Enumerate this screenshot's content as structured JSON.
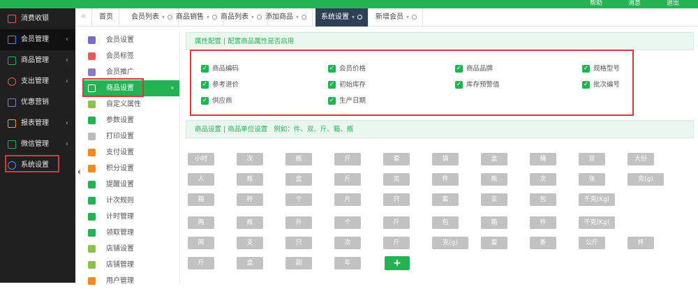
{
  "topbar": {
    "items": [
      "帮助",
      "消息",
      "退出"
    ],
    "color": "#24b353"
  },
  "sidebar": {
    "items": [
      {
        "label": "消费收银",
        "icon": "cashier-icon",
        "chevron": false
      },
      {
        "label": "会员管理",
        "icon": "members-icon",
        "chevron": true
      },
      {
        "label": "商品管理",
        "icon": "goods-icon",
        "chevron": true
      },
      {
        "label": "支出管理",
        "icon": "expense-icon",
        "chevron": true
      },
      {
        "label": "优惠营销",
        "icon": "gift-icon",
        "chevron": false
      },
      {
        "label": "报表管理",
        "icon": "report-icon",
        "chevron": true
      },
      {
        "label": "微信管理",
        "icon": "wechat-icon",
        "chevron": true
      },
      {
        "label": "系统设置",
        "icon": "gear-icon",
        "chevron": false
      }
    ]
  },
  "tabs": [
    {
      "label": "首页",
      "pin": false,
      "close": false
    },
    {
      "label": "会员列表",
      "pin": true,
      "close": true
    },
    {
      "label": "商品销售",
      "pin": true,
      "close": true
    },
    {
      "label": "商品列表",
      "pin": true,
      "close": true
    },
    {
      "label": "添加商品",
      "pin": true,
      "close": true
    },
    {
      "label": "系统设置",
      "pin": true,
      "close": true
    },
    {
      "label": "新增会员",
      "pin": true,
      "close": true
    }
  ],
  "submenu": {
    "items": [
      {
        "label": "会员设置",
        "color": "#7b68c9"
      },
      {
        "label": "会员标签",
        "color": "#e65c5c"
      },
      {
        "label": "会员推广",
        "color": "#8e7cc3"
      },
      {
        "label": "商品设置",
        "color": "#ffffff"
      },
      {
        "label": "自定义属性",
        "color": "#8cc152"
      },
      {
        "label": "参数设置",
        "color": "#24b353"
      },
      {
        "label": "打印设置",
        "color": "#bbbbbb"
      },
      {
        "label": "支付设置",
        "color": "#f08a24"
      },
      {
        "label": "积分设置",
        "color": "#f08a24"
      },
      {
        "label": "提醒设置",
        "color": "#24b353"
      },
      {
        "label": "计次规则",
        "color": "#24b353"
      },
      {
        "label": "计时管理",
        "color": "#24b353"
      },
      {
        "label": "领取管理",
        "color": "#24b353"
      },
      {
        "label": "店铺设置",
        "color": "#8cc152"
      },
      {
        "label": "店铺管理",
        "color": "#8cc152"
      },
      {
        "label": "用户管理",
        "color": "#f08a24"
      }
    ]
  },
  "attr_panel": {
    "title": "属性配置 | 配置商品属性是否启用"
  },
  "attributes": [
    "商品编码",
    "会员价格",
    "商品品牌",
    "规格型号",
    "参考进价",
    "初始库存",
    "库存预警值",
    "批次编号",
    "供应商",
    "生产日期"
  ],
  "unit_panel": {
    "title": "商品设置 | 商品单位设置",
    "example": "例如：件、双、斤、箱、瓶"
  },
  "units": [
    [
      "小时",
      "次",
      "瓶",
      "斤",
      "套",
      "袋",
      "盒",
      "桶",
      "双",
      "大份"
    ],
    [
      "人",
      "瓶",
      "盒",
      "斤",
      "克",
      "件",
      "瓶",
      "次",
      "张",
      "克(g)"
    ],
    [
      "箱",
      "杯",
      "个",
      "片",
      "只",
      "套",
      "支",
      "包",
      "千克(Kg)"
    ],
    [
      "两",
      "瓶",
      "升",
      "个",
      "斤",
      "包",
      "箱",
      "件",
      "千克(Kg)"
    ],
    [
      "两",
      "支",
      "只",
      "次",
      "斤",
      "克(g)",
      "套",
      "条",
      "公斤",
      "杯"
    ],
    [
      "斤",
      "盒",
      "副",
      "年"
    ]
  ],
  "add_unit_label": "+"
}
